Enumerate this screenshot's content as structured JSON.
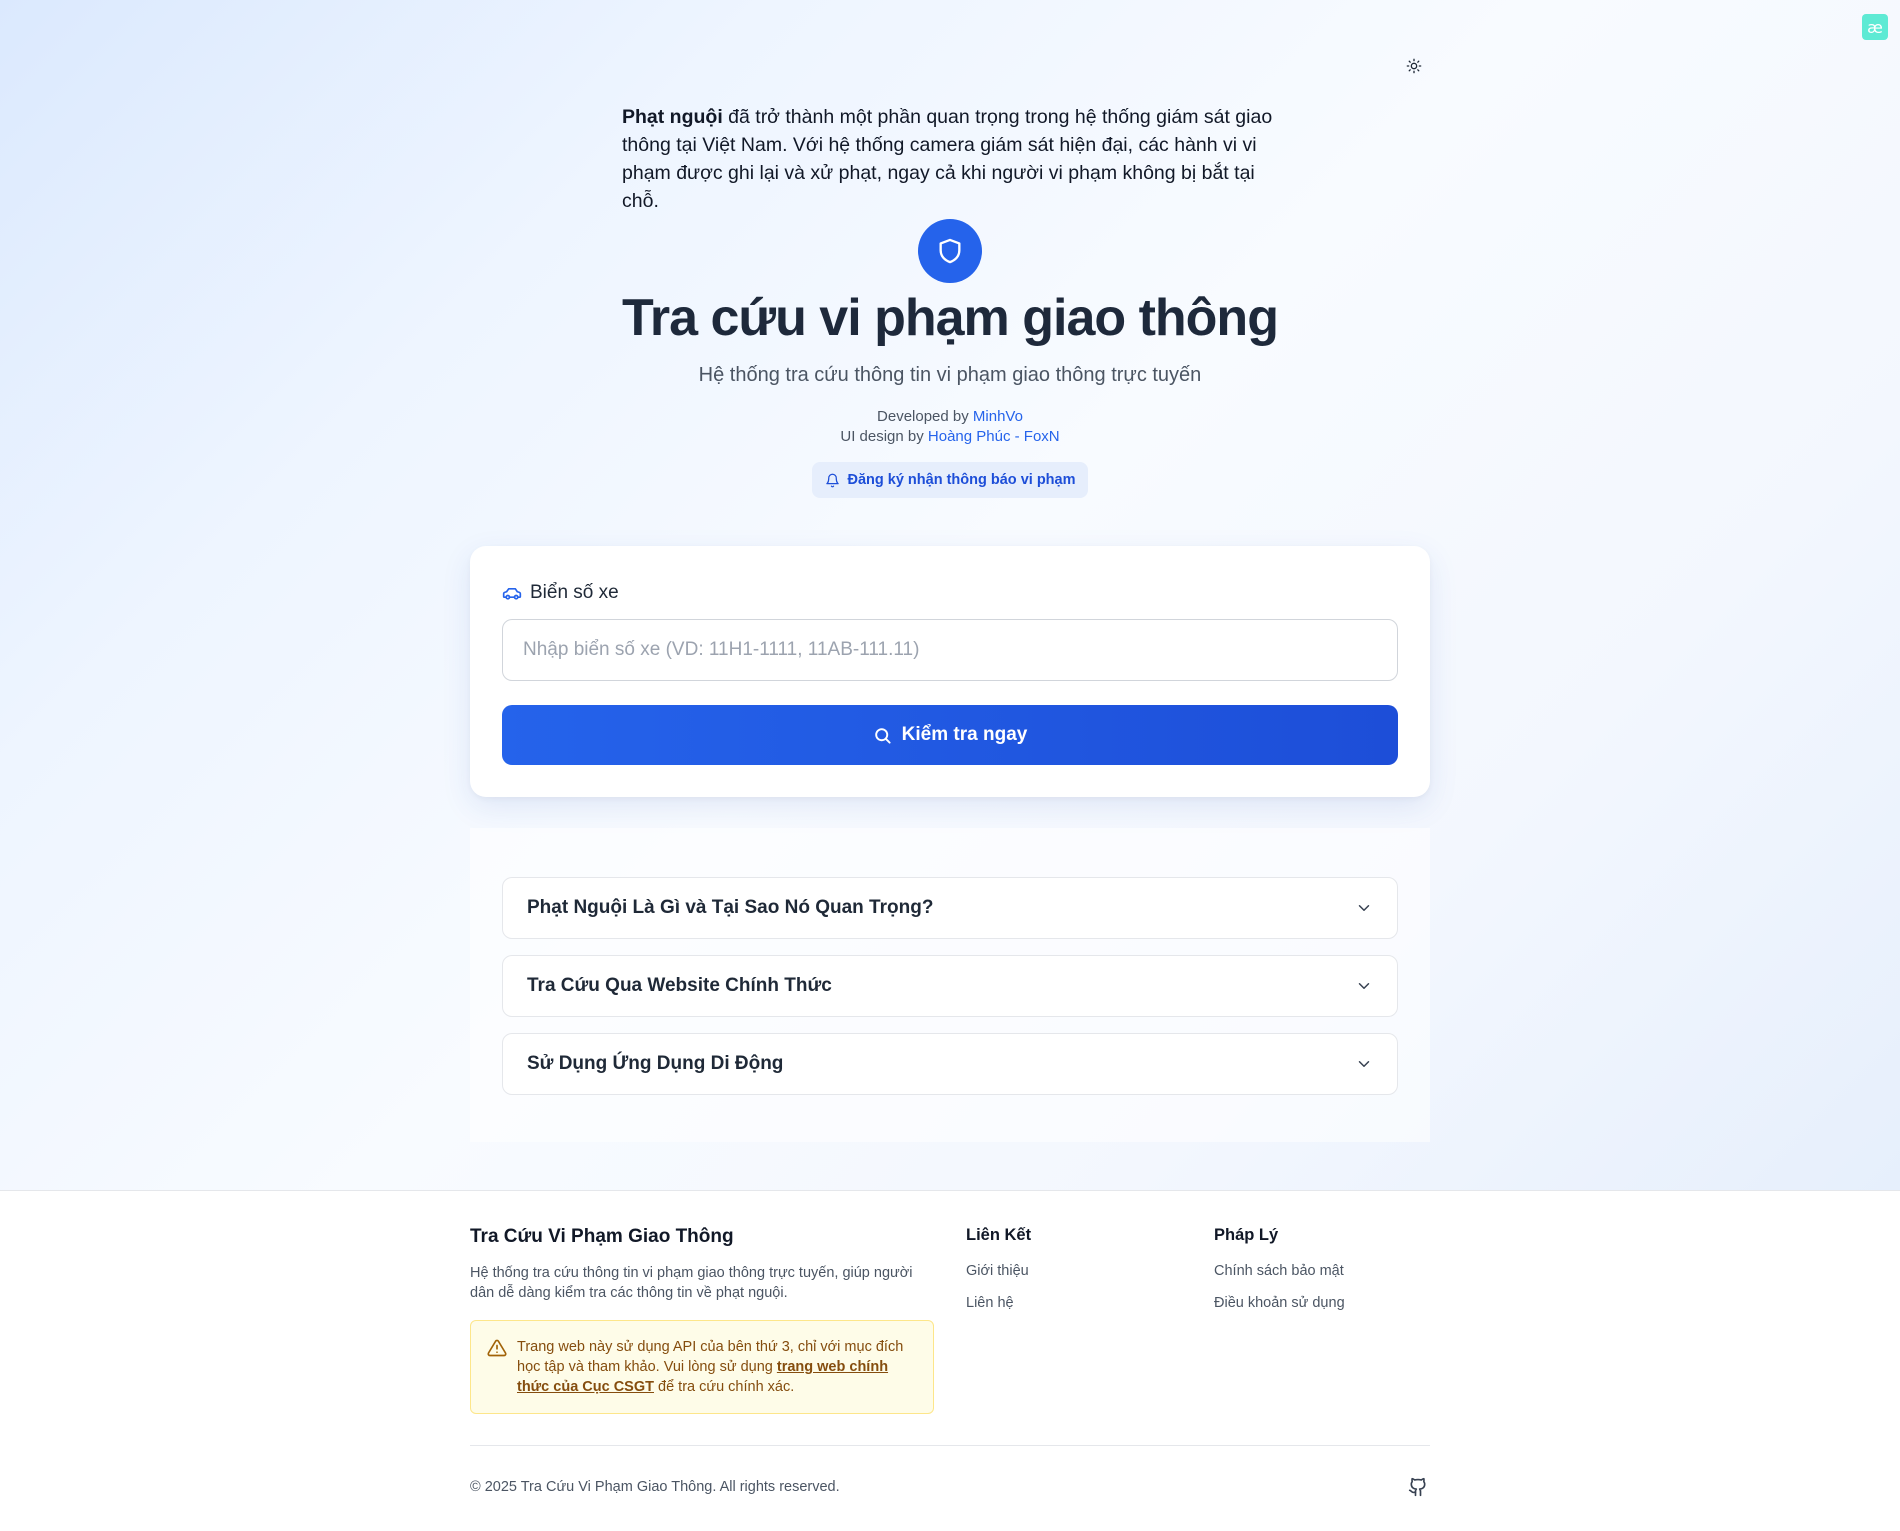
{
  "corner_badge": {
    "glyph": "æ",
    "color": "#5eead4"
  },
  "theme_toggle": {
    "icon": "sun-icon"
  },
  "intro": {
    "bold": "Phạt nguội",
    "text": " đã trở thành một phần quan trọng trong hệ thống giám sát giao thông tại Việt Nam. Với hệ thống camera giám sát hiện đại, các hành vi vi phạm được ghi lại và xử phạt, ngay cả khi người vi phạm không bị bắt tại chỗ."
  },
  "hero": {
    "icon": "shield-icon",
    "title": "Tra cứu vi phạm giao thông",
    "subtitle": "Hệ thống tra cứu thông tin vi phạm giao thông trực tuyến",
    "developed_prefix": "Developed by ",
    "developer": "MinhVo",
    "design_prefix": "UI design by ",
    "designer": "Hoàng Phúc - FoxN",
    "notify_label": "Đăng ký nhận thông báo vi phạm"
  },
  "search": {
    "label": "Biển số xe",
    "placeholder": "Nhập biển số xe (VD: 11H1-1111, 11AB-111.11)",
    "value": "",
    "button_label": "Kiểm tra ngay"
  },
  "faq": [
    {
      "title": "Phạt Nguội Là Gì và Tại Sao Nó Quan Trọng?"
    },
    {
      "title": "Tra Cứu Qua Website Chính Thức"
    },
    {
      "title": "Sử Dụng Ứng Dụng Di Động"
    }
  ],
  "footer": {
    "brand": "Tra Cứu Vi Phạm Giao Thông",
    "description": "Hệ thống tra cứu thông tin vi phạm giao thông trực tuyến, giúp người dân dễ dàng kiểm tra các thông tin về phạt nguội.",
    "warning_before": "Trang web này sử dụng API của bên thứ 3, chỉ với mục đích học tập và tham khảo. Vui lòng sử dụng ",
    "warning_link": "trang web chính thức của Cục CSGT",
    "warning_after": " để tra cứu chính xác.",
    "links_heading": "Liên Kết",
    "links": [
      "Giới thiệu",
      "Liên hệ"
    ],
    "legal_heading": "Pháp Lý",
    "legal": [
      "Chính sách bảo mật",
      "Điều khoản sử dụng"
    ],
    "copyright": "© 2025 Tra Cứu Vi Phạm Giao Thông. All rights reserved."
  },
  "colors": {
    "accent": "#2563eb",
    "accent_dark": "#1d4ed8",
    "warning_bg": "#fefce8",
    "warning_text": "#854d0e"
  }
}
